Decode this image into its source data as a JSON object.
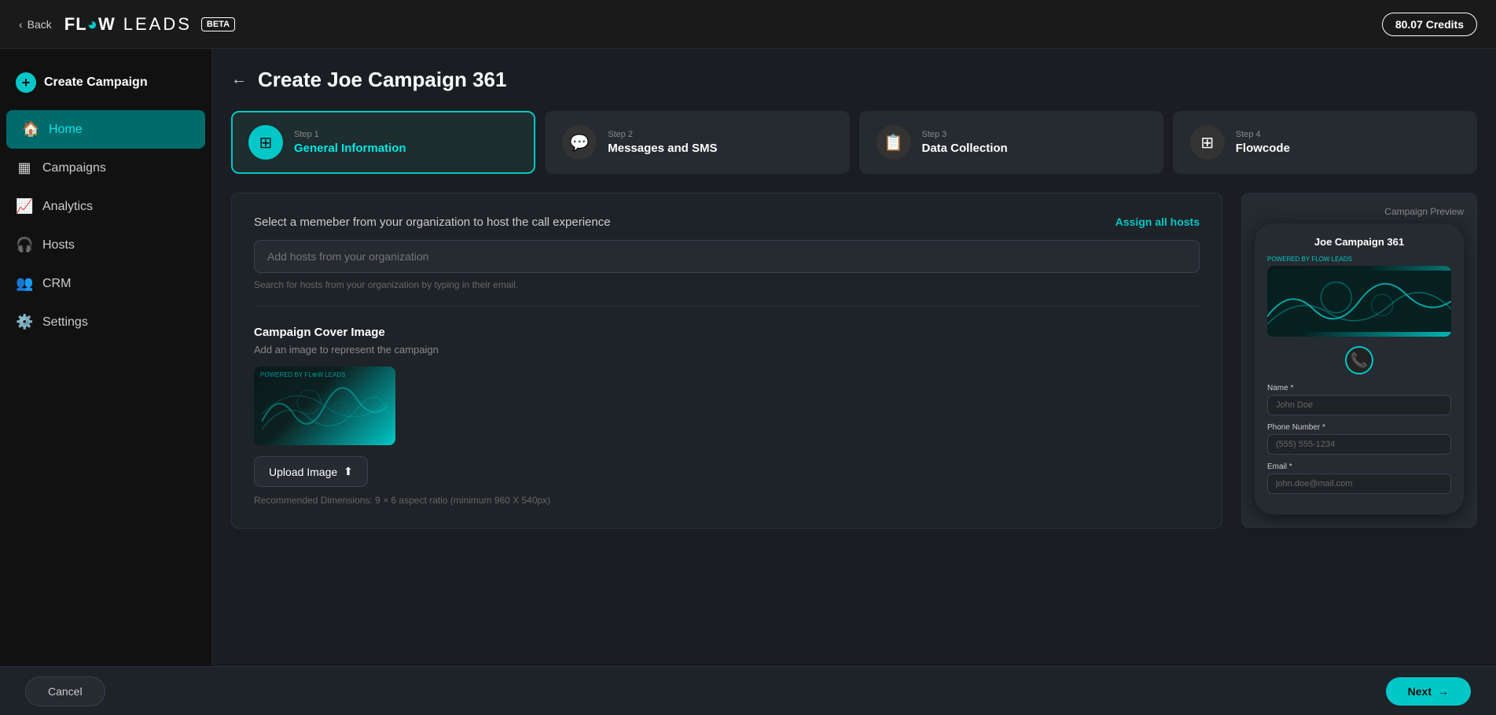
{
  "header": {
    "back_label": "Back",
    "logo_flow": "FL🔊W",
    "logo_leads": "LEADS",
    "logo_beta": "BETA",
    "credits": "80.07 Credits"
  },
  "sidebar": {
    "create_label": "Create Campaign",
    "nav_items": [
      {
        "id": "home",
        "label": "Home",
        "icon": "🏠",
        "active": true
      },
      {
        "id": "campaigns",
        "label": "Campaigns",
        "icon": "📊",
        "active": false
      },
      {
        "id": "analytics",
        "label": "Analytics",
        "icon": "📈",
        "active": false
      },
      {
        "id": "hosts",
        "label": "Hosts",
        "icon": "🎧",
        "active": false
      },
      {
        "id": "crm",
        "label": "CRM",
        "icon": "👥",
        "active": false
      },
      {
        "id": "settings",
        "label": "Settings",
        "icon": "⚙️",
        "active": false
      }
    ]
  },
  "page": {
    "title": "Create Joe Campaign 361",
    "steps": [
      {
        "id": "step1",
        "label": "Step 1",
        "title": "General Information",
        "icon": "⊞",
        "active": true
      },
      {
        "id": "step2",
        "label": "Step 2",
        "title": "Messages and SMS",
        "icon": "💬",
        "active": false
      },
      {
        "id": "step3",
        "label": "Step 3",
        "title": "Data Collection",
        "icon": "📋",
        "active": false
      },
      {
        "id": "step4",
        "label": "Step 4",
        "title": "Flowcode",
        "icon": "⊞",
        "active": false
      }
    ]
  },
  "form": {
    "host_section_desc": "Select a memeber from your organization to host the call experience",
    "assign_all_label": "Assign all hosts",
    "host_input_placeholder": "Add hosts from your organization",
    "host_hint": "Search for hosts from your organization by typing in their email.",
    "cover_title": "Campaign Cover Image",
    "cover_desc": "Add an image to represent the campaign",
    "upload_btn": "Upload Image",
    "rec_dims": "Recommended Dimensions: 9 × 6 aspect ratio (minimum 960 X 540px)"
  },
  "preview": {
    "campaign_name": "Joe Campaign 361",
    "powered_by": "POWERED BY FLOW LEADS",
    "fields": [
      {
        "label": "Name *",
        "placeholder": "John Doe"
      },
      {
        "label": "Phone Number *",
        "placeholder": "(555) 555-1234"
      },
      {
        "label": "Email *",
        "placeholder": "john.doe@mail.com"
      }
    ]
  },
  "bottom": {
    "cancel_label": "Cancel",
    "next_label": "Next"
  }
}
